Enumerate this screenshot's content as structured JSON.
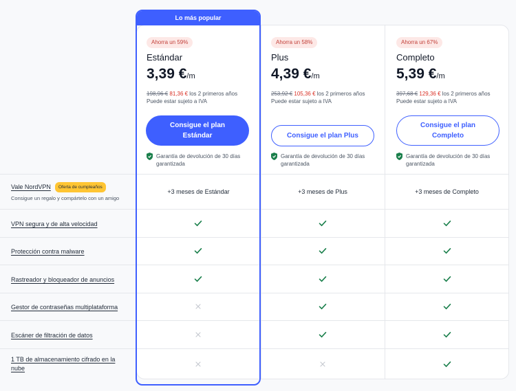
{
  "banner": "Lo más popular",
  "plans": [
    {
      "badge": "Ahorra un 59%",
      "name": "Estándar",
      "price": "3,39 €",
      "unit": "/m",
      "old_price": "198,96 €",
      "new_price": "81,36 €",
      "term": " los 2 primeros años",
      "vat": "Puede estar sujeto a IVA",
      "cta": "Consigue el plan Estándar",
      "guarantee": "Garantía de devolución de 30 días garantizada",
      "voucher": "+3 meses de Estándar"
    },
    {
      "badge": "Ahorra un 58%",
      "name": "Plus",
      "price": "4,39 €",
      "unit": "/m",
      "old_price": "253,92 €",
      "new_price": "105,36 €",
      "term": " los 2 primeros años",
      "vat": "Puede estar sujeto a IVA",
      "cta": "Consigue el plan Plus",
      "guarantee": "Garantía de devolución de 30 días garantizada",
      "voucher": "+3 meses de Plus"
    },
    {
      "badge": "Ahorra un 67%",
      "name": "Completo",
      "price": "5,39 €",
      "unit": "/m",
      "old_price": "397,68 €",
      "new_price": "129,36 €",
      "term": " los 2 primeros años",
      "vat": "Puede estar sujeto a IVA",
      "cta": "Consigue el plan Completo",
      "guarantee": "Garantía de devolución de 30 días garantizada",
      "voucher": "+3 meses de Completo"
    }
  ],
  "voucher_row": {
    "label": "Vale NordVPN",
    "tag": "Oferta de cumpleaños",
    "sub": "Consigue un regalo y compártelo con un amigo"
  },
  "features": [
    {
      "label": "VPN segura y de alta velocidad",
      "included": [
        true,
        true,
        true
      ]
    },
    {
      "label": "Protección contra malware",
      "included": [
        true,
        true,
        true
      ]
    },
    {
      "label": "Rastreador y bloqueador de anuncios",
      "included": [
        true,
        true,
        true
      ]
    },
    {
      "label": "Gestor de contraseñas multiplataforma",
      "included": [
        false,
        true,
        true
      ]
    },
    {
      "label": "Escáner de filtración de datos",
      "included": [
        false,
        true,
        true
      ]
    },
    {
      "label": "1 TB de almacenamiento cifrado en la nube",
      "included": [
        false,
        false,
        true
      ]
    }
  ],
  "colors": {
    "accent": "#3e5fff",
    "check": "#1a7f4b",
    "cross": "#c4c8cf",
    "discount": "#d93025",
    "badge_bg": "#fde8e6",
    "tag_bg": "#ffc533"
  }
}
